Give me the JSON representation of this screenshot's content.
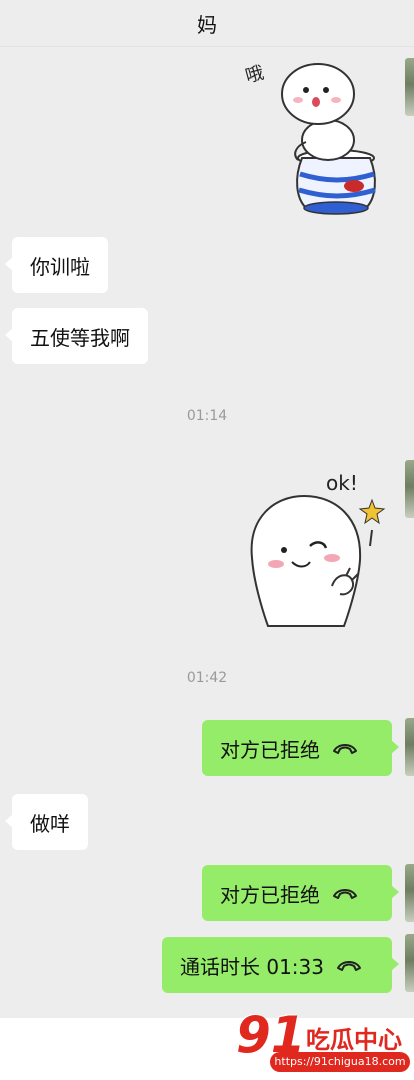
{
  "header": {
    "title": "妈"
  },
  "stickers": {
    "first": {
      "name": "vase-sticker",
      "caption": "哦"
    },
    "second": {
      "name": "ok-sticker",
      "caption": "ok!"
    }
  },
  "messages": {
    "m1": "你训啦",
    "m2": "五使等我啊",
    "t1": "01:14",
    "t2": "01:42",
    "m3": "对方已拒绝",
    "m4": "做咩",
    "m5": "对方已拒绝",
    "m6": "通话时长 01:33"
  },
  "watermark": {
    "number": "91",
    "text": "吃瓜中心",
    "url": "https://91chigua18.com"
  },
  "colors": {
    "background": "#ededed",
    "outgoing": "#95ec69",
    "incoming": "#ffffff",
    "brand_red": "#e0281f"
  }
}
